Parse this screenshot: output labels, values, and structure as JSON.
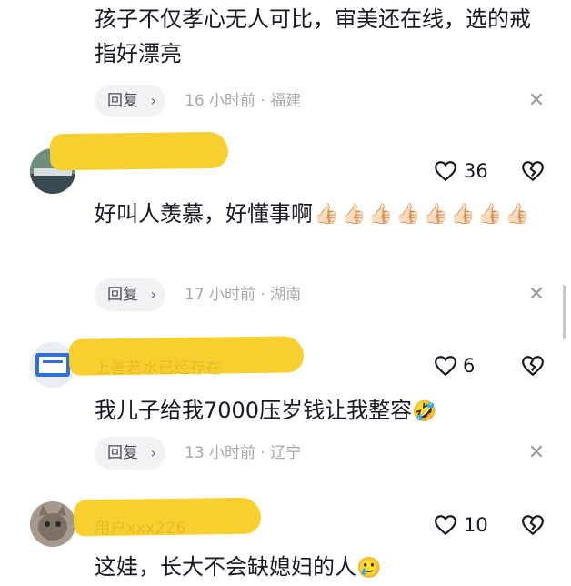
{
  "comments": [
    {
      "text": "孩子不仅孝心无人可比，审美还在线，选的戒指好漂亮",
      "reply_label": "回复",
      "meta": "16 小时前 · 福建"
    },
    {
      "text": "好叫人羡慕，好懂事啊",
      "emoji_count": 8,
      "emoji": "👍🏻",
      "likes": "36",
      "reply_label": "回复",
      "meta": "17 小时前 · 湖南"
    },
    {
      "username": "上善若水已经存在",
      "text": "我儿子给我7000压岁钱让我整容",
      "emoji": "🤣",
      "likes": "6",
      "reply_label": "回复",
      "meta": "13 小时前 · 辽宁"
    },
    {
      "username": "用户xxx226",
      "text": "这娃，长大不会缺媳妇的人",
      "emoji": "🥲",
      "likes": "10"
    }
  ],
  "colors": {
    "highlight": "#f7cf2f",
    "meta_text": "#a6a8ae",
    "reply_bg": "#f2f2f4"
  },
  "icons": [
    "heart-outline-icon",
    "broken-heart-icon",
    "close-icon",
    "chevron-right-icon"
  ]
}
